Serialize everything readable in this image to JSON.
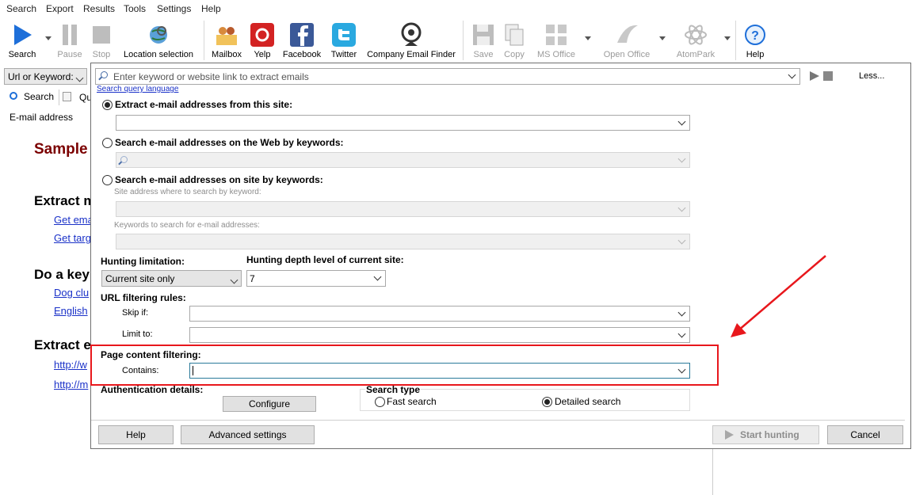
{
  "menu": [
    "Search",
    "Export",
    "Results",
    "Tools",
    "Settings",
    "Help"
  ],
  "toolbar": {
    "search": "Search",
    "pause": "Pause",
    "stop": "Stop",
    "location": "Location selection",
    "mailbox": "Mailbox",
    "yelp": "Yelp",
    "facebook": "Facebook",
    "twitter": "Twitter",
    "company": "Company Email Finder",
    "save": "Save",
    "copy": "Copy",
    "msoffice": "MS Office",
    "openoffice": "Open Office",
    "atompark": "AtomPark",
    "help": "Help"
  },
  "left": {
    "mode_select": "Url or Keyword:",
    "tab_search": "Search",
    "tab_query": "Qu",
    "email_label": "E-mail address",
    "heading_sample": "Sample",
    "heading_extract": "Extract m",
    "link_get_email": "Get ema",
    "link_get_target": "Get targ",
    "heading_keyword": "Do a key",
    "link_dog": "Dog clu",
    "link_english": "English",
    "heading_extract2": "Extract e",
    "link_http1": "http://w",
    "link_http2": "http://m"
  },
  "dialog": {
    "search_placeholder": "Enter keyword or website link to extract emails",
    "less": "Less...",
    "query_language": "Search query language",
    "opt_site": "Extract e-mail addresses from this site:",
    "opt_web": "Search e-mail addresses on the Web by keywords:",
    "opt_site_kw": "Search e-mail addresses on site by keywords:",
    "site_address_label": "Site address where to search by keyword:",
    "keywords_label": "Keywords to search for e-mail addresses:",
    "hunting_limitation": "Hunting limitation:",
    "hunting_limitation_value": "Current site only",
    "depth_label": "Hunting depth level of current site:",
    "depth_value": "7",
    "url_filter": "URL filtering rules:",
    "skip_if": "Skip if:",
    "limit_to": "Limit to:",
    "page_filter": "Page content filtering:",
    "contains": "Contains:",
    "auth": "Authentication details:",
    "configure": "Configure",
    "search_type": "Search type",
    "fast_search": "Fast search",
    "detailed_search": "Detailed search",
    "help_btn": "Help",
    "advanced_btn": "Advanced settings",
    "start_btn": "Start hunting",
    "cancel_btn": "Cancel"
  },
  "colors": {
    "annotation": "#e8171c",
    "link": "#1a31c8",
    "heading": "#7b0000"
  }
}
